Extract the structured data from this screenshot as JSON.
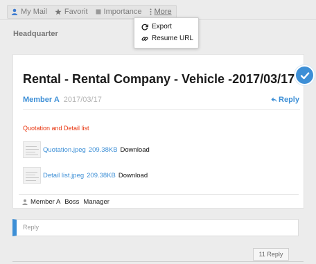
{
  "tabs": [
    {
      "label": "My Mail",
      "icon": "user-icon"
    },
    {
      "label": "Favorit",
      "icon": "star-icon"
    },
    {
      "label": "Importance",
      "icon": "square-icon"
    },
    {
      "label": "More",
      "icon": "dots-icon"
    }
  ],
  "dropdown": {
    "items": [
      {
        "label": "Export",
        "icon": "export-icon"
      },
      {
        "label": "Resume URL",
        "icon": "link-icon"
      }
    ]
  },
  "folder_title": "Headquarter",
  "message": {
    "title": "Rental - Rental Company - Vehicle -2017/03/17",
    "author": "Member A",
    "date": "2017/03/17",
    "reply_label": "Reply",
    "quotation_title": "Quotation and Detail list",
    "attachments": [
      {
        "name": "Quotation.jpeg",
        "size": "209.38KB",
        "action": "Download"
      },
      {
        "name": "Detail list.jpeg",
        "size": "209.38KB",
        "action": "Download"
      }
    ],
    "recipients": [
      "Member A",
      "Boss",
      "Manager"
    ]
  },
  "reply_input": {
    "placeholder": "Reply",
    "value": ""
  },
  "reply_count": "11 Reply",
  "colors": {
    "accent": "#3d8fd6",
    "alert": "#e8350f"
  }
}
